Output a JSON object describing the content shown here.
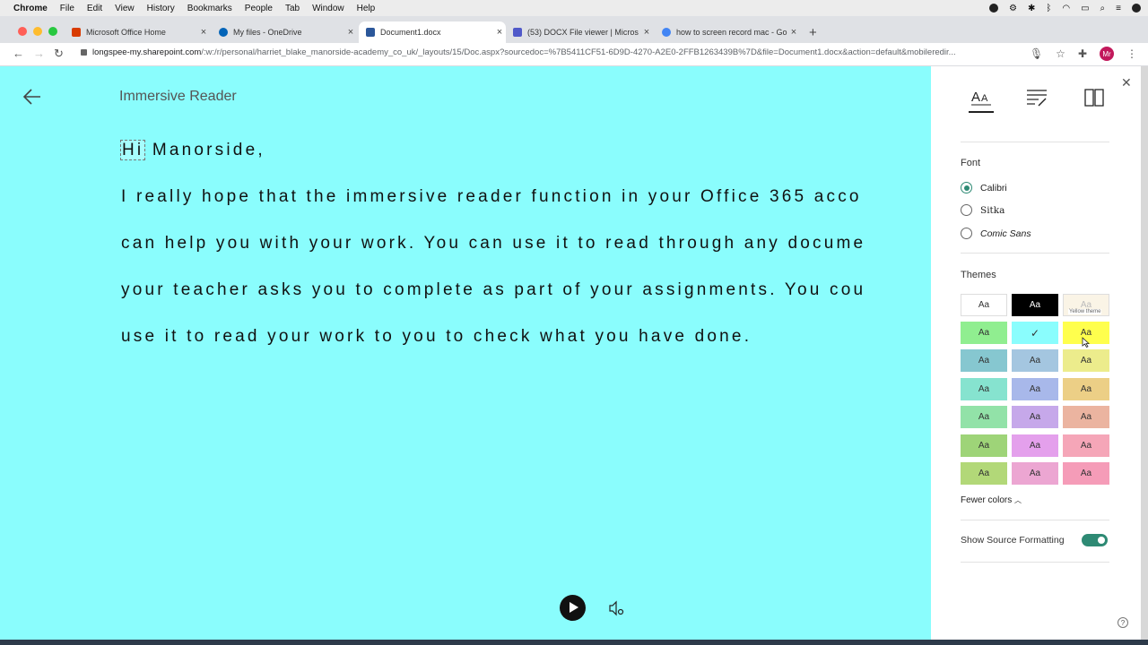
{
  "menubar": {
    "app": "Chrome",
    "items": [
      "File",
      "Edit",
      "View",
      "History",
      "Bookmarks",
      "People",
      "Tab",
      "Window",
      "Help"
    ]
  },
  "tabs": [
    {
      "label": "Microsoft Office Home",
      "color": "#d83b01"
    },
    {
      "label": "My files - OneDrive",
      "color": "#0364b8"
    },
    {
      "label": "Document1.docx",
      "color": "#2b579a"
    },
    {
      "label": "(53) DOCX File viewer | Micros",
      "color": "#5059c9"
    },
    {
      "label": "how to screen record mac - Go",
      "color": "#4285f4"
    }
  ],
  "address": {
    "host": "longspee-my.sharepoint.com",
    "path": "/:w:/r/personal/harriet_blake_manorside-academy_co_uk/_layouts/15/Doc.aspx?sourcedoc=%7B5411CF51-6D9D-4270-A2E0-2FFB1263439B%7D&file=Document1.docx&action=default&mobileredir..."
  },
  "profile": {
    "initials": "Mr"
  },
  "reader": {
    "title": "Immersive Reader",
    "background": "#8afdfd",
    "greeting_word": "Hi",
    "greeting_rest": " Manorside,",
    "lines": [
      "I really hope that the immersive reader function in your Office 365 acco",
      "can help you with your work. You can use it to read through any docume",
      "your teacher asks you to complete as part of your assignments. You cou",
      "use it to read your work to you to check what you have done."
    ]
  },
  "panel": {
    "font_title": "Font",
    "fonts": [
      "Calibri",
      "Sitka",
      "Comic Sans"
    ],
    "selected_font": "Calibri",
    "themes_title": "Themes",
    "swatch_label": "Aa",
    "tooltip": "Yellow theme",
    "swatch_colors": [
      [
        "#ffffff",
        "#000000",
        "#faf4e6"
      ],
      [
        "#90ee90",
        "#8afdfd",
        "#ffff4d"
      ],
      [
        "#86c7d0",
        "#a4c6e0",
        "#ecec8c"
      ],
      [
        "#86e3cf",
        "#a8b8ea",
        "#eccf86"
      ],
      [
        "#92e2a8",
        "#c6a8ea",
        "#ebb4a0"
      ],
      [
        "#9ed478",
        "#e4a0ec",
        "#f5a6b8"
      ],
      [
        "#b2d878",
        "#eca6d2",
        "#f59cb8"
      ]
    ],
    "selected_theme": "cyan",
    "fewer_colors": "Fewer colors",
    "show_source_formatting": "Show Source Formatting",
    "show_source_formatting_on": true
  }
}
